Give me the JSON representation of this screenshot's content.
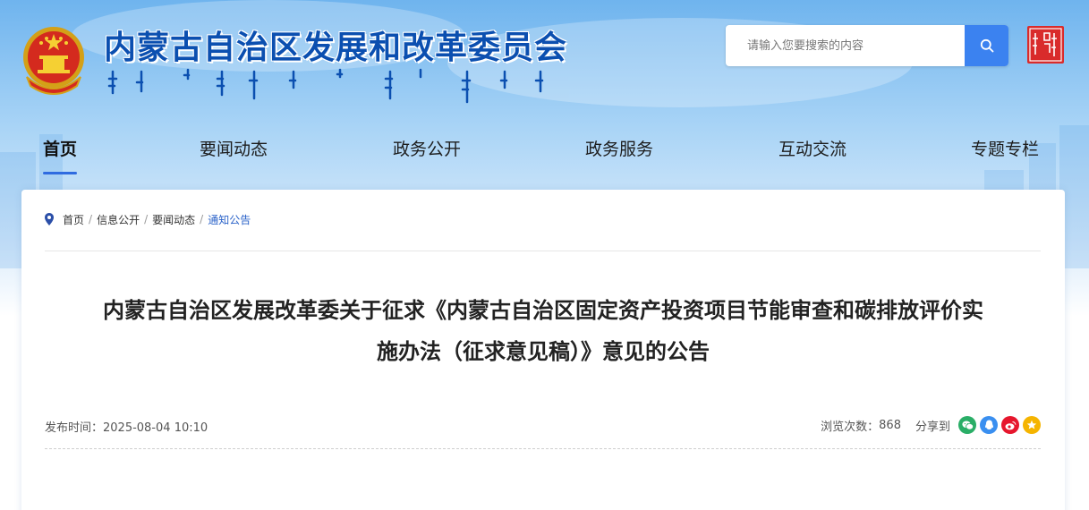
{
  "header": {
    "site_title": "内蒙古自治区发展和改革委员会",
    "search_placeholder": "请输入您要搜索的内容",
    "search_value": ""
  },
  "nav": {
    "items": [
      {
        "label": "首页",
        "active": true
      },
      {
        "label": "要闻动态"
      },
      {
        "label": "政务公开"
      },
      {
        "label": "政务服务"
      },
      {
        "label": "互动交流"
      },
      {
        "label": "专题专栏"
      }
    ]
  },
  "breadcrumb": {
    "items": [
      "首页",
      "信息公开",
      "要闻动态",
      "通知公告"
    ],
    "separator": "/"
  },
  "article": {
    "title_line1": "内蒙古自治区发展改革委关于征求《内蒙古自治区固定资产投资项目节能审查和碳排放评价实",
    "title_line2": "施办法（征求意见稿）》意见的公告",
    "publish_label": "发布时间：",
    "publish_time": "2025-08-04 10:10",
    "views_label": "浏览次数：",
    "views": "868",
    "share_label": "分享到"
  },
  "share_icons": [
    {
      "name": "wechat-icon",
      "color": "#2aae67"
    },
    {
      "name": "qq-icon",
      "color": "#3a8ff0"
    },
    {
      "name": "weibo-icon",
      "color": "#e6162d"
    },
    {
      "name": "qzone-icon",
      "color": "#f5b400"
    }
  ],
  "colors": {
    "accent": "#2f6be0",
    "title_blue": "#0b4fb0",
    "search_button": "#3b82f0",
    "breadcrumb_current": "#2b63c9"
  }
}
